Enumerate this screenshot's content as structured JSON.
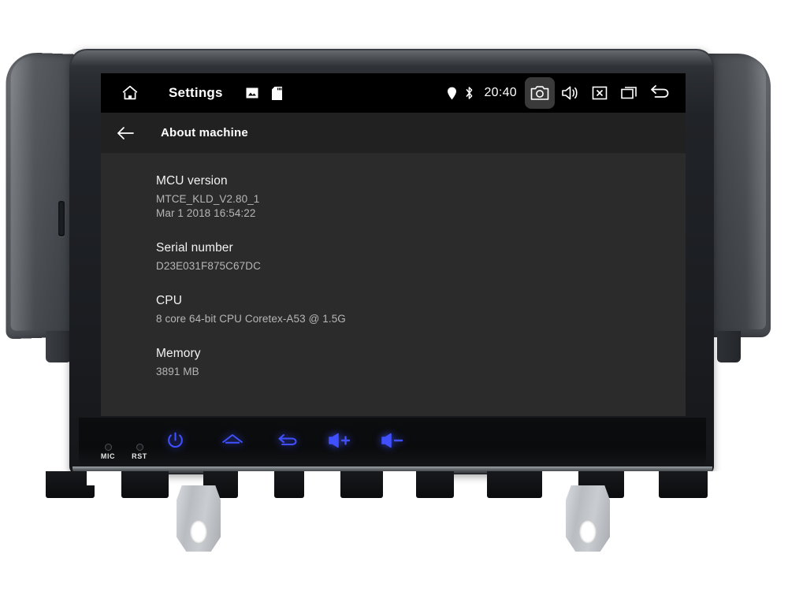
{
  "device": {
    "labels": {
      "mic": "MIC",
      "rst": "RST"
    },
    "buttons": [
      {
        "name": "power",
        "icon": "power-icon"
      },
      {
        "name": "home",
        "icon": "home-icon"
      },
      {
        "name": "back",
        "icon": "back-icon"
      },
      {
        "name": "volume-up",
        "icon": "volume-up-icon"
      },
      {
        "name": "volume-down",
        "icon": "volume-down-icon"
      }
    ],
    "accent_color": "#3d4dff"
  },
  "statusbar": {
    "home_icon": "home-icon",
    "title": "Settings",
    "mini_icons": [
      {
        "name": "gallery-icon"
      },
      {
        "name": "sdcard-icon"
      }
    ],
    "location_icon": "location-pin-icon",
    "bluetooth_icon": "bluetooth-icon",
    "clock": "20:40",
    "right_icons": [
      {
        "name": "screenshot-icon",
        "highlighted": true
      },
      {
        "name": "volume-icon",
        "highlighted": false
      },
      {
        "name": "close-icon",
        "highlighted": false
      },
      {
        "name": "recents-icon",
        "highlighted": false
      },
      {
        "name": "back-icon",
        "highlighted": false
      }
    ],
    "background": "#000000"
  },
  "appbar": {
    "back_icon": "arrow-left-icon",
    "title": "About machine",
    "background": "#212121"
  },
  "content": {
    "background": "#2b2b2b",
    "items": [
      {
        "title": "MCU version",
        "value": "MTCE_KLD_V2.80_1\nMar  1 2018 16:54:22"
      },
      {
        "title": "Serial number",
        "value": "D23E031F875C67DC"
      },
      {
        "title": "CPU",
        "value": "8 core 64-bit CPU Coretex-A53 @ 1.5G"
      },
      {
        "title": "Memory",
        "value": "3891 MB"
      }
    ]
  }
}
